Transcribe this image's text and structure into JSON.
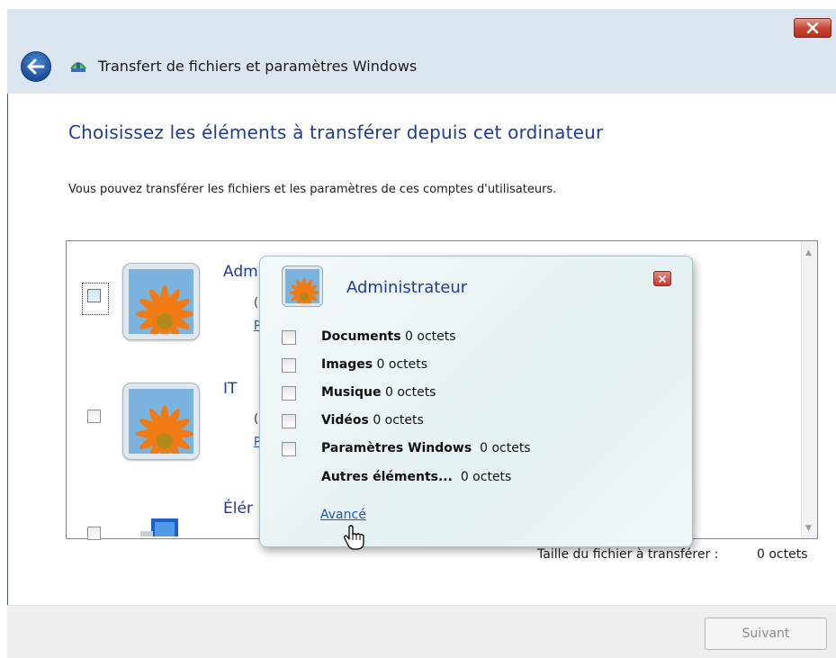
{
  "window": {
    "title": "Transfert de fichiers et paramètres Windows"
  },
  "page": {
    "heading": "Choisissez les éléments à transférer depuis cet ordinateur",
    "description": "Vous pouvez transférer les fichiers et les paramètres de ces comptes d'utilisateurs."
  },
  "accounts": [
    {
      "name": "Adm",
      "size": "(",
      "link": "P"
    },
    {
      "name": "IT",
      "size": "(",
      "link": "P"
    },
    {
      "name": "Élér",
      "size": ""
    }
  ],
  "popup": {
    "title": "Administrateur",
    "items": [
      {
        "label": "Documents",
        "size": "0 octets"
      },
      {
        "label": "Images",
        "size": "0 octets"
      },
      {
        "label": "Musique",
        "size": "0 octets"
      },
      {
        "label": "Vidéos",
        "size": "0 octets"
      },
      {
        "label": "Paramètres Windows",
        "size": "0 octets"
      },
      {
        "label": "Autres éléments...",
        "size": "0 octets"
      }
    ],
    "advanced_link": "Avancé"
  },
  "transfer": {
    "size_label": "Taille du fichier à transférer :",
    "size_value": "0 octets"
  },
  "footer": {
    "next_label": "Suivant"
  },
  "colors": {
    "heading": "#1f3b9a",
    "link": "#1f55b8",
    "close_red": "#c9473a"
  }
}
